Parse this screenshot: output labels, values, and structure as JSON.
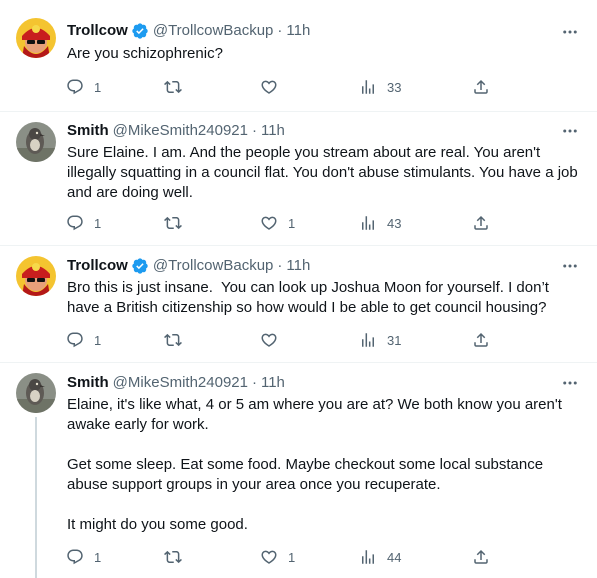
{
  "tweets": [
    {
      "name": "Trollcow",
      "verified": true,
      "handle": "@TrollcowBackup",
      "dot": "·",
      "time": "11h",
      "text": "Are you schizophrenic?",
      "replies": "1",
      "retweets": "",
      "likes": "",
      "views": "33"
    },
    {
      "name": "Smith",
      "verified": false,
      "handle": "@MikeSmith240921",
      "dot": "·",
      "time": "11h",
      "text": "Sure Elaine. I am. And the people you stream about are real. You aren't illegally squatting in a council flat. You don't abuse stimulants. You have a job and are doing well.",
      "replies": "1",
      "retweets": "",
      "likes": "1",
      "views": "43"
    },
    {
      "name": "Trollcow",
      "verified": true,
      "handle": "@TrollcowBackup",
      "dot": "·",
      "time": "11h",
      "text": "Bro this is just insane.  You can look up Joshua Moon for yourself. I don’t have a British citizenship so how would I be able to get council housing?",
      "replies": "1",
      "retweets": "",
      "likes": "",
      "views": "31"
    },
    {
      "name": "Smith",
      "verified": false,
      "handle": "@MikeSmith240921",
      "dot": "·",
      "time": "11h",
      "text": "Elaine, it's like what, 4 or 5 am where you are at? We both know you aren't awake early for work.\n\nGet some sleep. Eat some food. Maybe checkout some local substance abuse support groups in your area once you recuperate.\n\nIt might do you some good.",
      "replies": "1",
      "retweets": "",
      "likes": "1",
      "views": "44"
    }
  ],
  "colors": {
    "text": "#0f1419",
    "secondary": "#536471",
    "verified": "#1d9bf0",
    "divider": "#eff3f4",
    "thread_line": "#cfd9de"
  },
  "icons": {
    "reply": "reply-icon",
    "retweet": "retweet-icon",
    "like": "heart-icon",
    "views": "views-icon",
    "share": "share-icon",
    "more": "more-icon",
    "verified": "verified-badge-icon"
  }
}
